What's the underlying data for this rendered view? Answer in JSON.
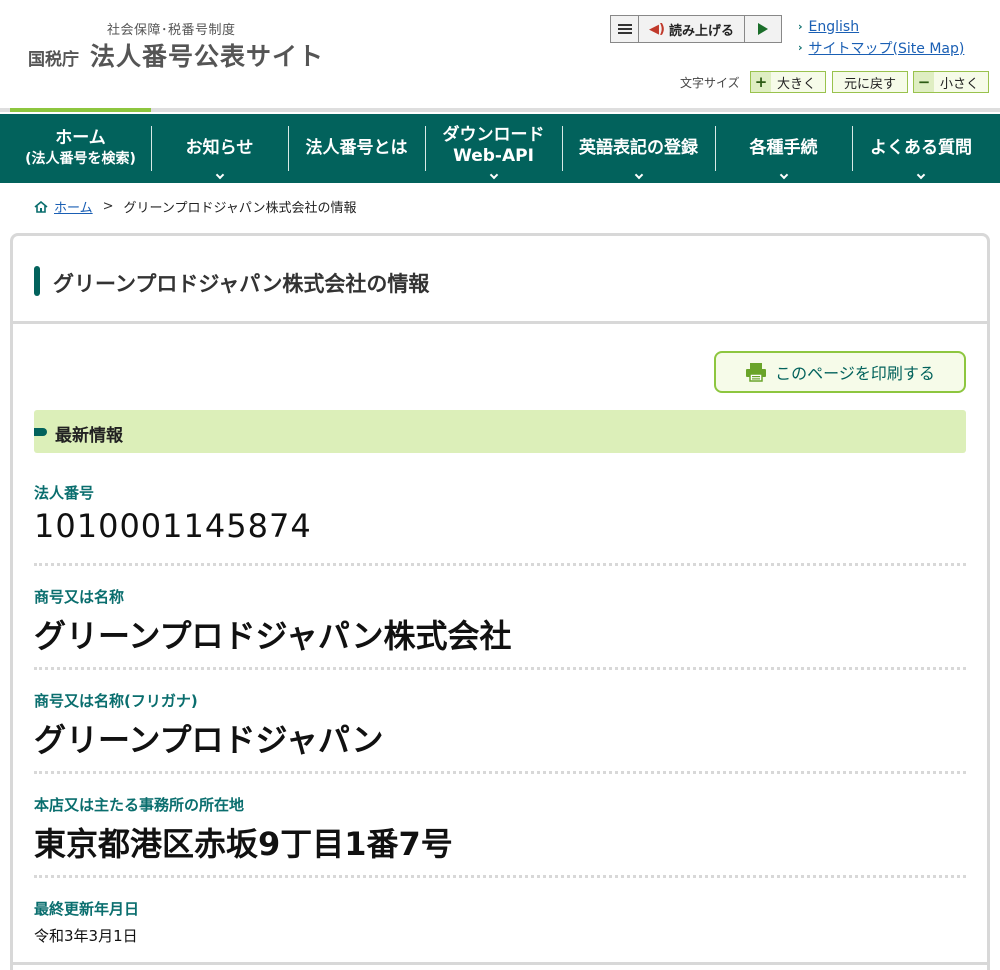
{
  "header": {
    "subtitle": "社会保障･税番号制度",
    "agency": "国税庁",
    "title": "法人番号公表サイト",
    "tts": {
      "read_label": "読み上げる"
    },
    "links": {
      "english": "English",
      "sitemap": "サイトマップ(Site Map)"
    },
    "font_size": {
      "label": "文字サイズ",
      "larger_symbol": "+",
      "larger": "大きく",
      "reset": "元に戻す",
      "smaller_symbol": "−",
      "smaller": "小さく"
    }
  },
  "nav": {
    "home_line1": "ホーム",
    "home_line2": "(法人番号を検索)",
    "news": "お知らせ",
    "about": "法人番号とは",
    "download_line1": "ダウンロード",
    "download_line2": "Web-API",
    "english_name": "英語表記の登録",
    "procedures": "各種手続",
    "faq": "よくある質問"
  },
  "breadcrumb": {
    "home": "ホーム",
    "separator": ">",
    "current": "グリーンプロドジャパン株式会社の情報"
  },
  "main": {
    "title": "グリーンプロドジャパン株式会社の情報",
    "print_label": "このページを印刷する",
    "section_title": "最新情報",
    "fields": [
      {
        "label": "法人番号",
        "value": "1010001145874"
      },
      {
        "label": "商号又は名称",
        "value": "グリーンプロドジャパン株式会社"
      },
      {
        "label": "商号又は名称(フリガナ)",
        "value": "グリーンプロドジャパン"
      },
      {
        "label": "本店又は主たる事務所の所在地",
        "value": "東京都港区赤坂9丁目1番7号"
      },
      {
        "label": "最終更新年月日",
        "value": "令和3年3月1日"
      }
    ]
  },
  "colors": {
    "nav": "#02625c",
    "accent_green": "#8dc63f",
    "section_bg": "#dcefb9",
    "link": "#1a5fb4"
  }
}
